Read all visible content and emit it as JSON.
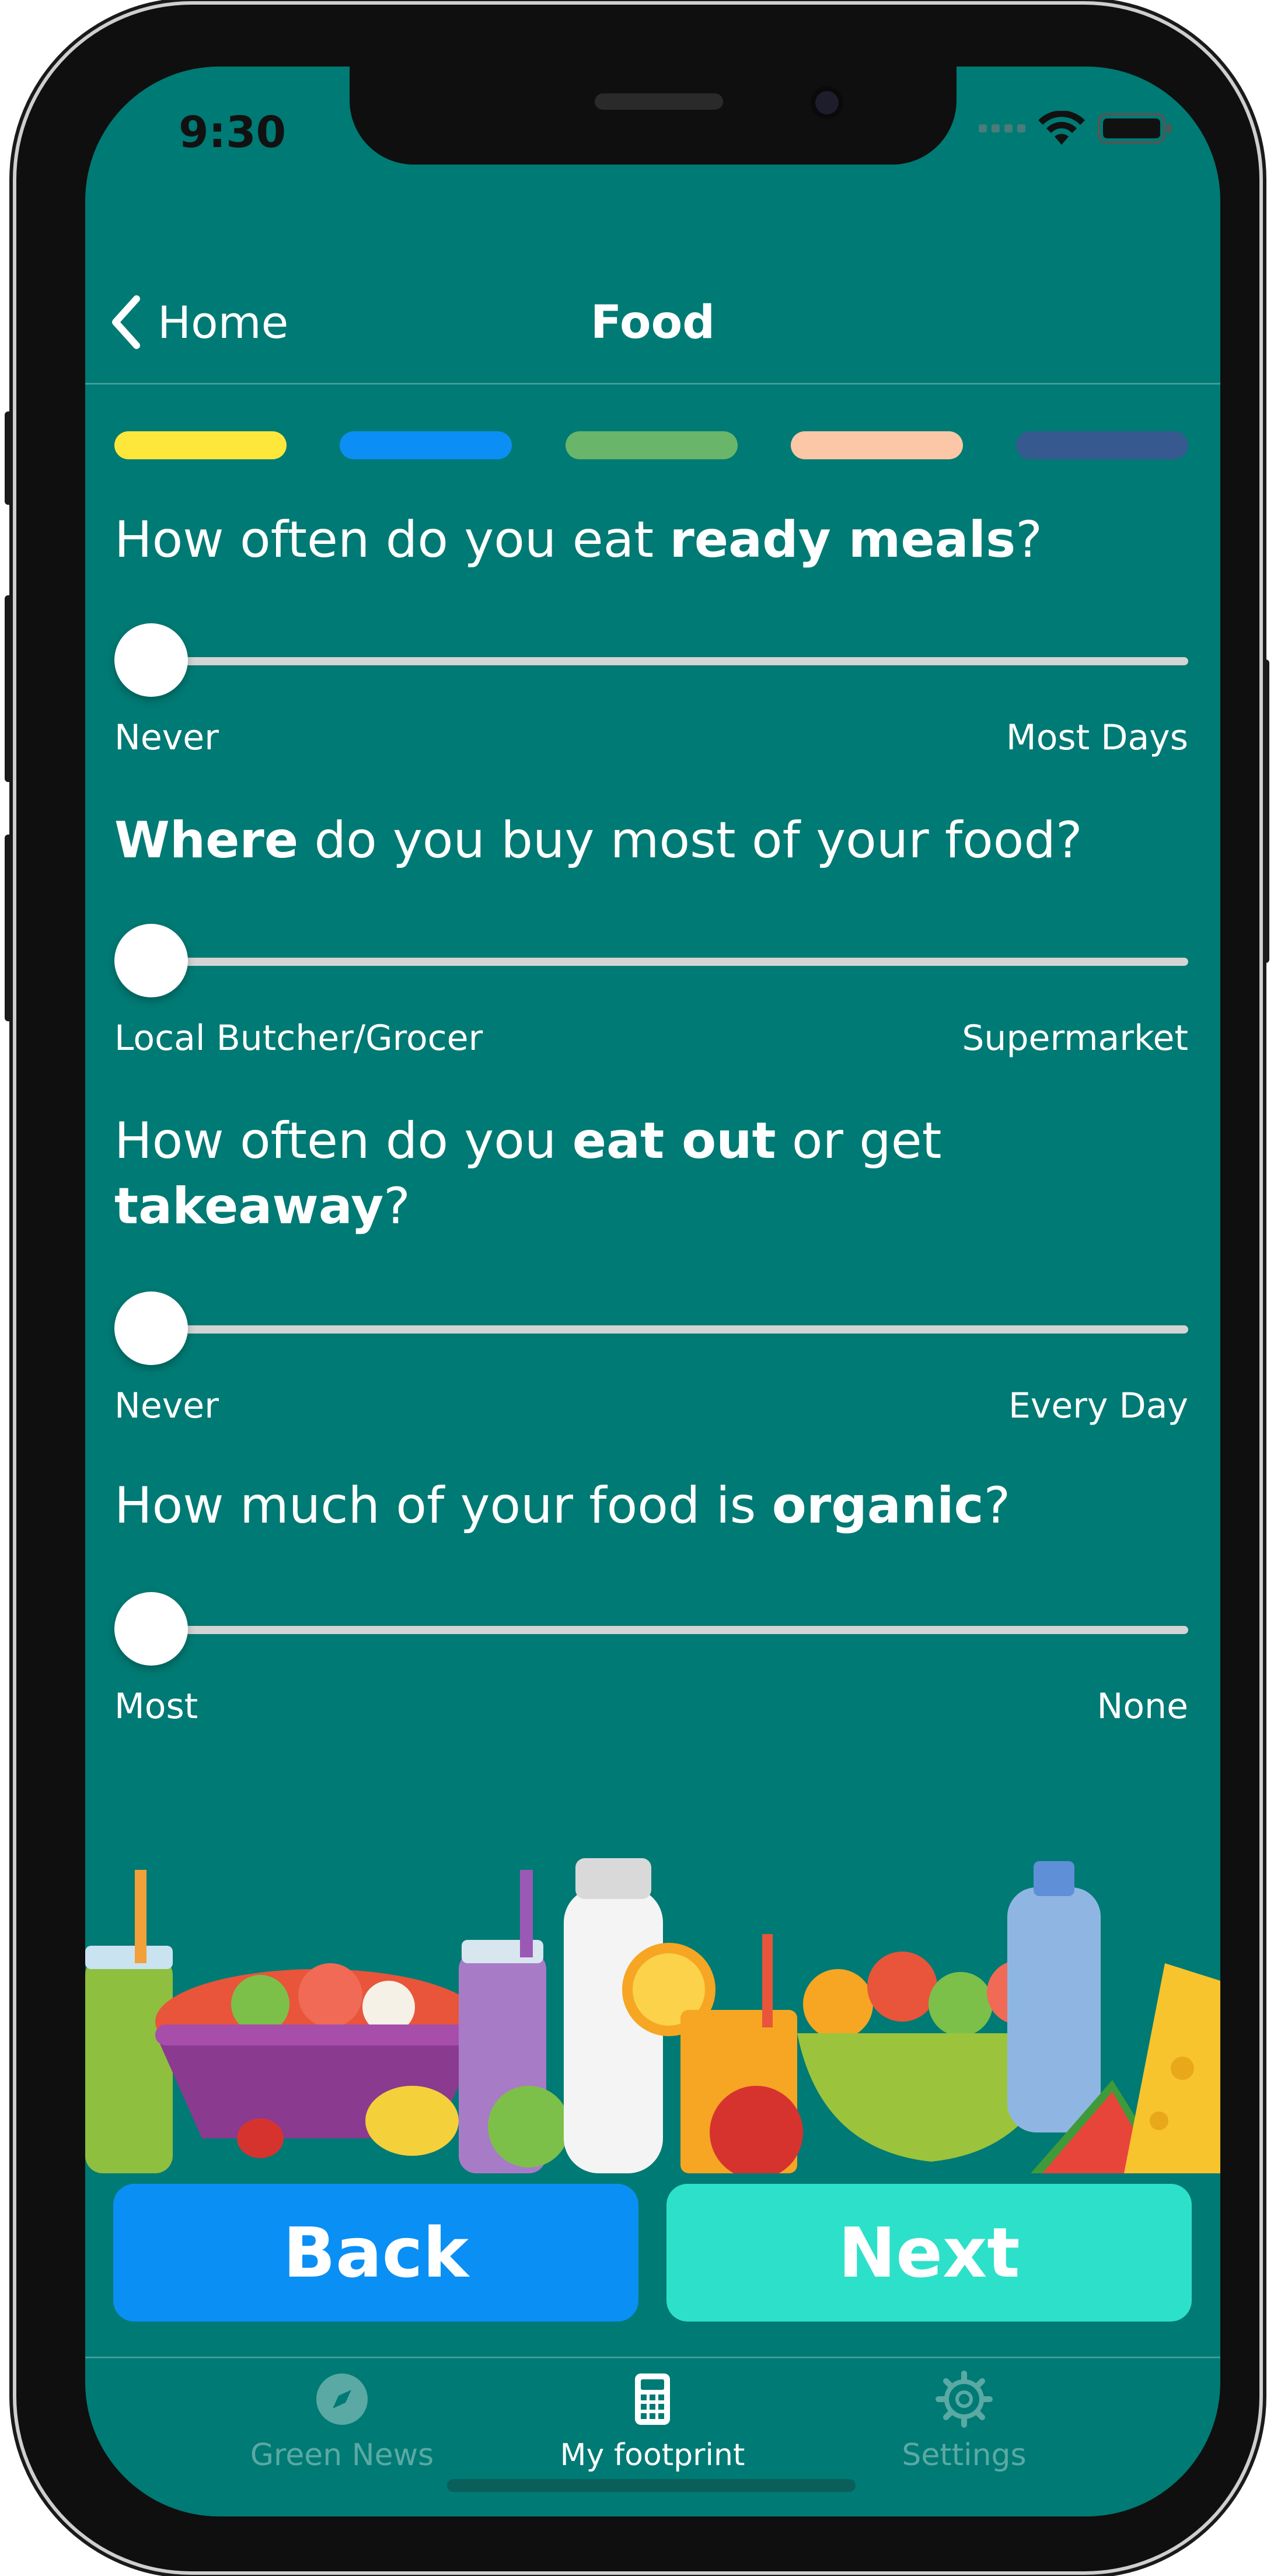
{
  "status_bar": {
    "time": "9:30"
  },
  "nav": {
    "back_label": "Home",
    "title": "Food"
  },
  "progress": {
    "steps": [
      {
        "color": "#fde73a"
      },
      {
        "color": "#0b8ff5"
      },
      {
        "color": "#69b56a"
      },
      {
        "color": "#fcc7a6"
      },
      {
        "color": "#365a8f"
      }
    ]
  },
  "questions": [
    {
      "pre": "How often do you eat ",
      "bold": "ready meals",
      "post": "?",
      "min_label": "Never",
      "max_label": "Most Days",
      "value": 0
    },
    {
      "pre": "",
      "bold": "Where",
      "post": " do you buy most of your food?",
      "min_label": "Local Butcher/Grocer",
      "max_label": "Supermarket",
      "value": 0
    },
    {
      "pre": "How often do you ",
      "bold": "eat out",
      "mid": " or get ",
      "bold2": "takeaway",
      "post": "?",
      "min_label": "Never",
      "max_label": "Every Day",
      "value": 0
    },
    {
      "pre": "How much of your food is ",
      "bold": "organic",
      "post": "?",
      "min_label": "Most",
      "max_label": "None",
      "value": 0
    }
  ],
  "buttons": {
    "back": "Back",
    "next": "Next"
  },
  "tabbar": {
    "tabs": [
      {
        "label": "Green News",
        "icon": "compass-icon",
        "active": false
      },
      {
        "label": "My footprint",
        "icon": "calculator-icon",
        "active": true
      },
      {
        "label": "Settings",
        "icon": "gear-icon",
        "active": false
      }
    ]
  },
  "colors": {
    "background": "#007a74",
    "back_button": "#0a8ff5",
    "next_button": "#2de0c9",
    "slider_track": "#d4d4d4"
  }
}
